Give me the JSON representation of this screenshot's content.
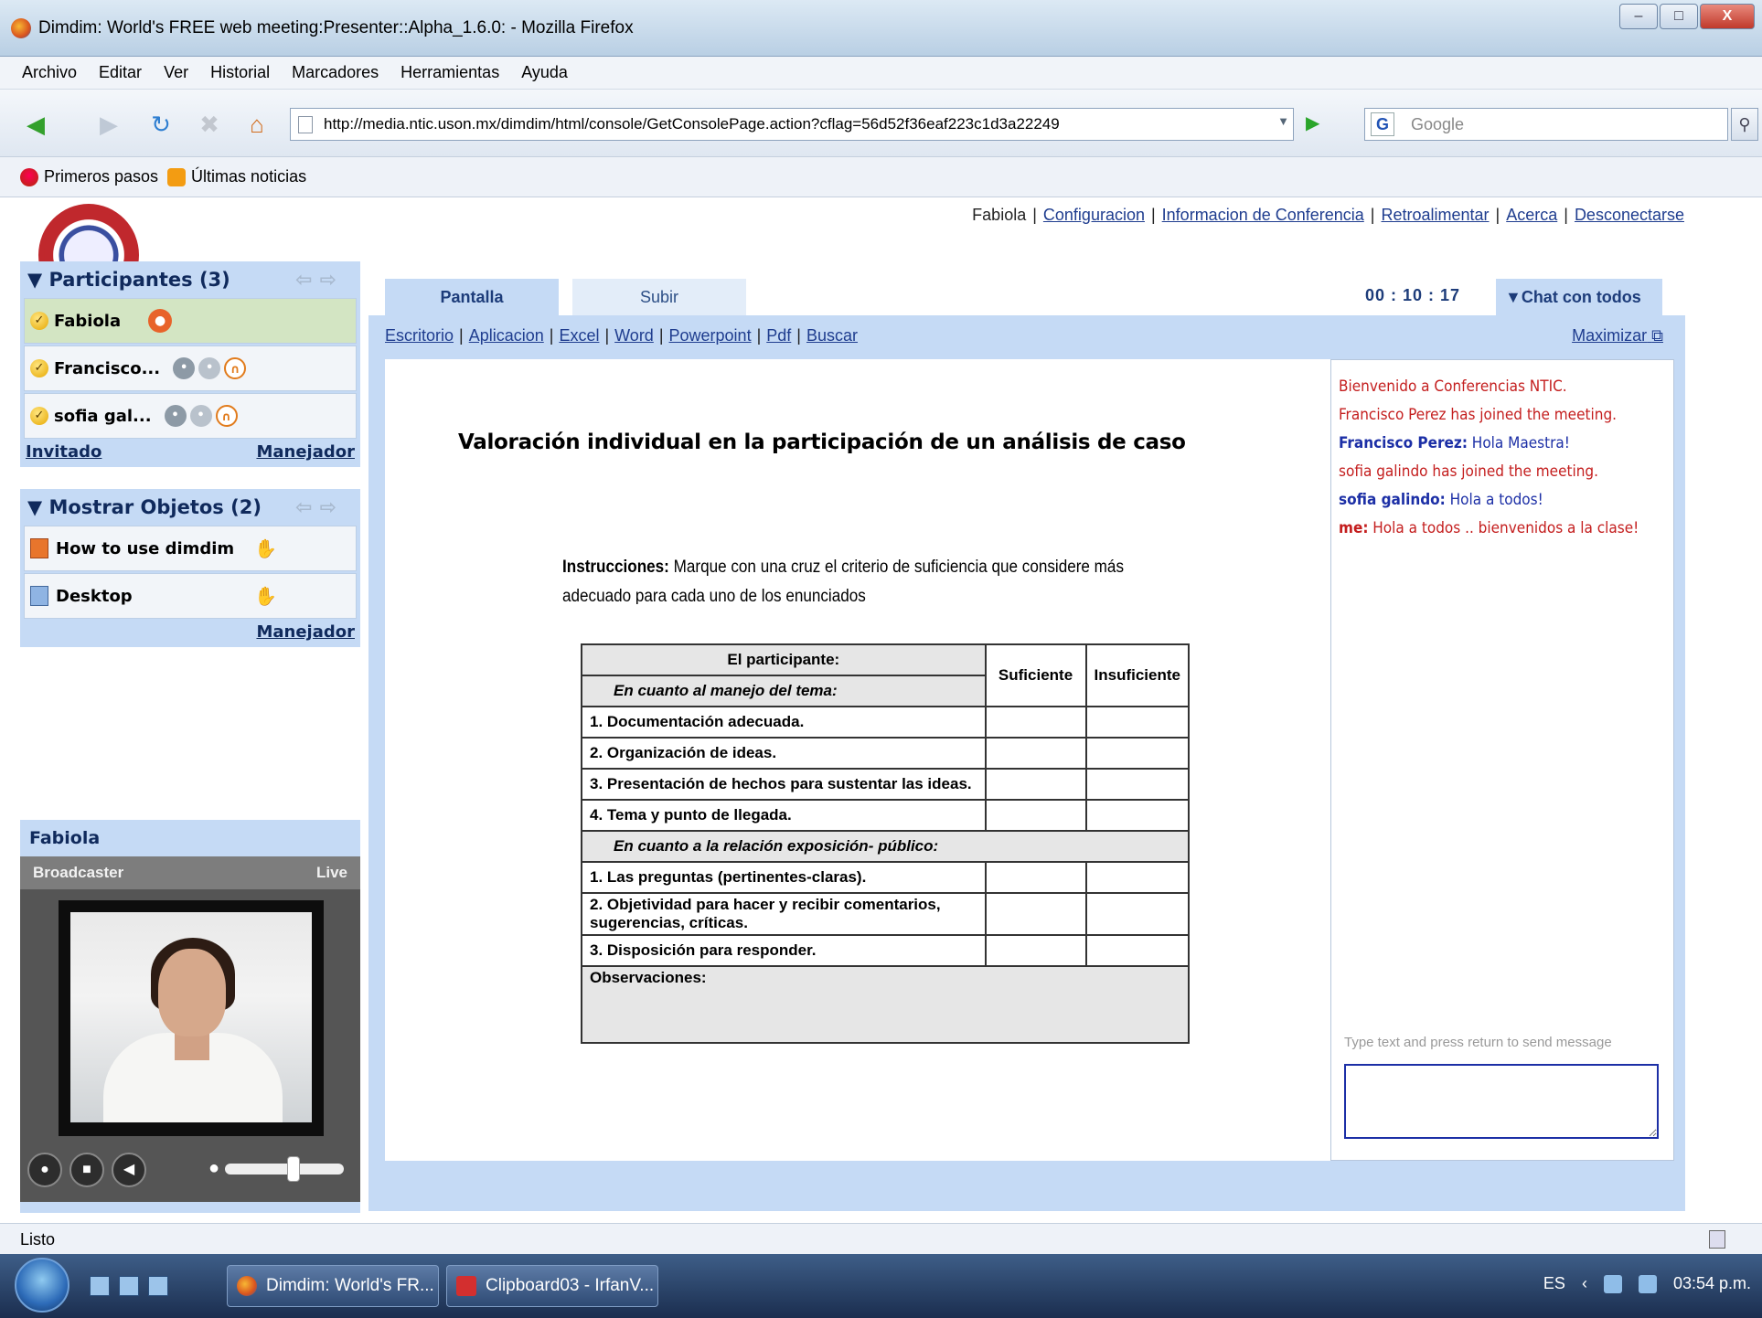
{
  "window": {
    "title": "Dimdim: World's FREE web meeting:Presenter::Alpha_1.6.0: - Mozilla Firefox",
    "buttons": [
      "–",
      "□",
      "X"
    ]
  },
  "menu": [
    "Archivo",
    "Editar",
    "Ver",
    "Historial",
    "Marcadores",
    "Herramientas",
    "Ayuda"
  ],
  "nav": {
    "url": "http://media.ntic.uson.mx/dimdim/html/console/GetConsolePage.action?cflag=56d52f36eaf223c1d3a22249",
    "search_placeholder": "Google",
    "search_engine_glyph": "G"
  },
  "bookmarks": [
    "Primeros pasos",
    "Últimas noticias"
  ],
  "header": {
    "user": "Fabiola",
    "links": [
      "Configuracion",
      "Informacion de Conferencia",
      "Retroalimentar",
      "Acerca",
      "Desconectarse"
    ]
  },
  "tabs": [
    "Pantalla",
    "Subir"
  ],
  "timer": "00 : 10 : 17",
  "chat_tab": "▼Chat con todos",
  "participants": {
    "title": "▼ Participantes (3)",
    "items": [
      {
        "name": "Fabiola"
      },
      {
        "name": "Francisco..."
      },
      {
        "name": "sofia gal..."
      }
    ],
    "invite": "Invitado",
    "manage": "Manejador"
  },
  "objects": {
    "title": "▼ Mostrar Objetos (2)",
    "items": [
      {
        "name": "How to use dimdim"
      },
      {
        "name": "Desktop"
      }
    ],
    "manage": "Manejador"
  },
  "video": {
    "name": "Fabiola",
    "role": "Broadcaster",
    "status": "Live"
  },
  "share_links": [
    "Escritorio",
    "Aplicacion",
    "Excel",
    "Word",
    "Powerpoint",
    "Pdf",
    "Buscar"
  ],
  "maximize": "Maximizar",
  "document": {
    "title": "Valoración individual en la participación de un análisis de caso",
    "instructions_label": "Instrucciones:",
    "instructions_text": " Marque con una cruz el criterio de suficiencia que considere más adecuado para cada uno de los enunciados",
    "table": {
      "header": "El participante:",
      "col1": "Suficiente",
      "col2": "Insuficiente",
      "section1": "En cuanto al manejo del tema:",
      "rows1": [
        "1. Documentación adecuada.",
        "2. Organización de ideas.",
        "3. Presentación de hechos para sustentar las ideas.",
        "4. Tema y punto de llegada."
      ],
      "section2": "En cuanto a la relación exposición- público:",
      "rows2": [
        "1. Las preguntas (pertinentes-claras).",
        "2. Objetividad para hacer y recibir comentarios, sugerencias, críticas.",
        "3. Disposición para responder."
      ],
      "observations": "Observaciones:"
    }
  },
  "chat": {
    "messages": [
      {
        "type": "sys",
        "text": "Bienvenido a Conferencias NTIC."
      },
      {
        "type": "sys",
        "text": "Francisco Perez has joined the meeting."
      },
      {
        "type": "usr",
        "from": "Francisco Perez:",
        "text": " Hola Maestra!"
      },
      {
        "type": "sys",
        "text": "sofia galindo has joined the meeting."
      },
      {
        "type": "usr",
        "from": "sofia galindo:",
        "text": " Hola a todos!"
      },
      {
        "type": "me",
        "from": "me:",
        "text": " Hola a todos .. bienvenidos a la clase!"
      }
    ],
    "hint": "Type text and press return to send message",
    "input_value": ""
  },
  "status": "Listo",
  "taskbar": {
    "buttons": [
      "Dimdim: World's FR...",
      "Clipboard03 - IrfanV..."
    ],
    "lang": "ES",
    "time": "03:54 p.m."
  },
  "colors": {
    "panel": "#c5daf5",
    "link": "#1f3d8f",
    "chat_system": "#c41e1e",
    "chat_user": "#1c2fa6"
  }
}
